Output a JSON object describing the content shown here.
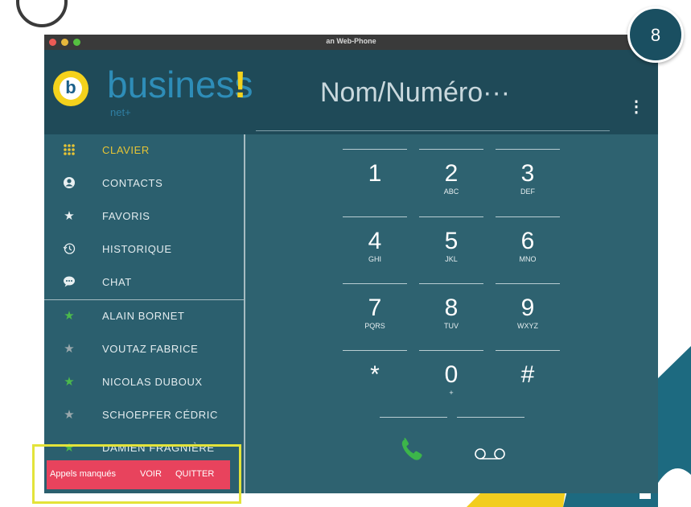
{
  "window": {
    "title": "an Web-Phone"
  },
  "brand": {
    "name": "business",
    "exclamation": "!",
    "sub": "net+",
    "logo_letter": "b"
  },
  "search": {
    "placeholder": "Nom/Numéro···"
  },
  "sidebar": {
    "items": [
      {
        "label": "CLAVIER",
        "icon": "keypad-icon"
      },
      {
        "label": "CONTACTS",
        "icon": "user-icon"
      },
      {
        "label": "FAVORIS",
        "icon": "star-icon"
      },
      {
        "label": "HISTORIQUE",
        "icon": "history-icon"
      },
      {
        "label": "CHAT",
        "icon": "chat-icon"
      }
    ],
    "favorites": [
      {
        "label": "ALAIN BORNET",
        "status": "online"
      },
      {
        "label": "VOUTAZ FABRICE",
        "status": "offline"
      },
      {
        "label": "NICOLAS DUBOUX",
        "status": "online"
      },
      {
        "label": "SCHOEPFER CÉDRIC",
        "status": "offline"
      },
      {
        "label": "DAMIEN FRAGNIÈRE",
        "status": "online"
      }
    ]
  },
  "keypad": {
    "keys": [
      {
        "digit": "1",
        "letters": ""
      },
      {
        "digit": "2",
        "letters": "ABC"
      },
      {
        "digit": "3",
        "letters": "DEF"
      },
      {
        "digit": "4",
        "letters": "GHI"
      },
      {
        "digit": "5",
        "letters": "JKL"
      },
      {
        "digit": "6",
        "letters": "MNO"
      },
      {
        "digit": "7",
        "letters": "PQRS"
      },
      {
        "digit": "8",
        "letters": "TUV"
      },
      {
        "digit": "9",
        "letters": "WXYZ"
      },
      {
        "digit": "*",
        "letters": ""
      },
      {
        "digit": "0",
        "letters": "+"
      },
      {
        "digit": "#",
        "letters": ""
      }
    ]
  },
  "notification": {
    "text": "Appels manqués",
    "view_label": "VOIR",
    "quit_label": "QUITTER"
  },
  "step": {
    "number": "8"
  },
  "colors": {
    "accent": "#e6c435",
    "notification": "#e8435d",
    "online": "#4cba4c",
    "call": "#3cb54a"
  }
}
